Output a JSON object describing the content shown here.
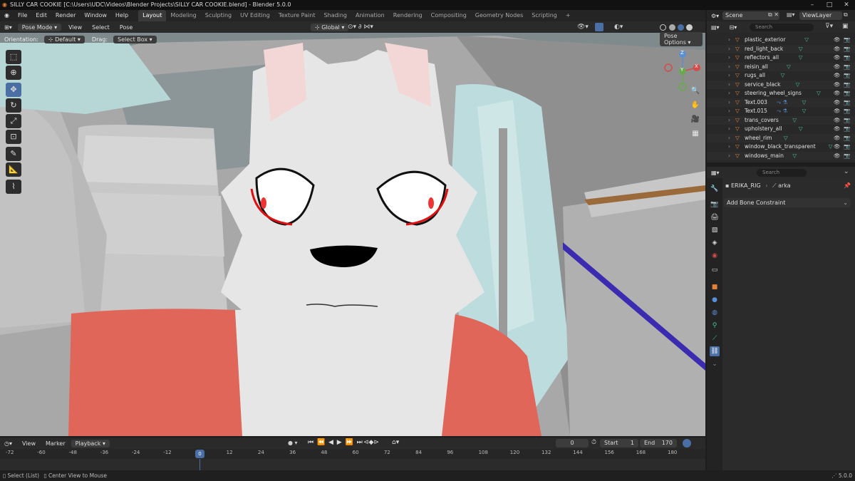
{
  "title": "SILLY CAR COOKIE [C:\\Users\\UDC\\Videos\\Blender Projects\\SILLY CAR COOKIE.blend] - Blender 5.0.0",
  "menus": [
    "File",
    "Edit",
    "Render",
    "Window",
    "Help"
  ],
  "workspaces": [
    "Layout",
    "Modeling",
    "Sculpting",
    "UV Editing",
    "Texture Paint",
    "Shading",
    "Animation",
    "Rendering",
    "Compositing",
    "Geometry Nodes",
    "Scripting"
  ],
  "active_workspace": "Layout",
  "scene": "Scene",
  "view_layer": "ViewLayer",
  "viewport": {
    "mode": "Pose Mode",
    "menu": [
      "View",
      "Select",
      "Pose"
    ],
    "transform": "Global",
    "orientation_label": "Orientation:",
    "orientation_value": "Default",
    "drag_label": "Drag:",
    "drag_value": "Select Box",
    "pose_options": "Pose Options",
    "axes": {
      "x": "X",
      "y": "Y",
      "z": "Z"
    }
  },
  "outliner": {
    "search_placeholder": "Search",
    "items": [
      "plastic_exterior",
      "red_light_back",
      "reflectors_all",
      "reisin_all",
      "rugs_all",
      "service_black",
      "steering_wheel_signs",
      "Text.003",
      "Text.015",
      "trans_covers",
      "upholstery_all",
      "wheel_rim",
      "window_black_transparent",
      "windows_main"
    ]
  },
  "properties": {
    "search_placeholder": "Search",
    "object": "ERIKA_RIG",
    "bone": "arka",
    "add_constraint": "Add Bone Constraint"
  },
  "timeline": {
    "menus": [
      "View",
      "Marker",
      "Playback"
    ],
    "current_frame": "0",
    "start_label": "Start",
    "start": "1",
    "end_label": "End",
    "end": "170",
    "ticks": [
      "-72",
      "-60",
      "-48",
      "-36",
      "-24",
      "-12",
      "0",
      "12",
      "24",
      "36",
      "48",
      "60",
      "72",
      "84",
      "96",
      "108",
      "120",
      "132",
      "144",
      "156",
      "168",
      "180"
    ]
  },
  "status": {
    "select": "Select (List)",
    "center": "Center View to Mouse",
    "version": "5.0.0"
  },
  "colors": {
    "accent": "#4a6fa5",
    "mesh_icon": "#e3833b",
    "shirt": "#e0665a",
    "fur": "#e6e6e6"
  }
}
